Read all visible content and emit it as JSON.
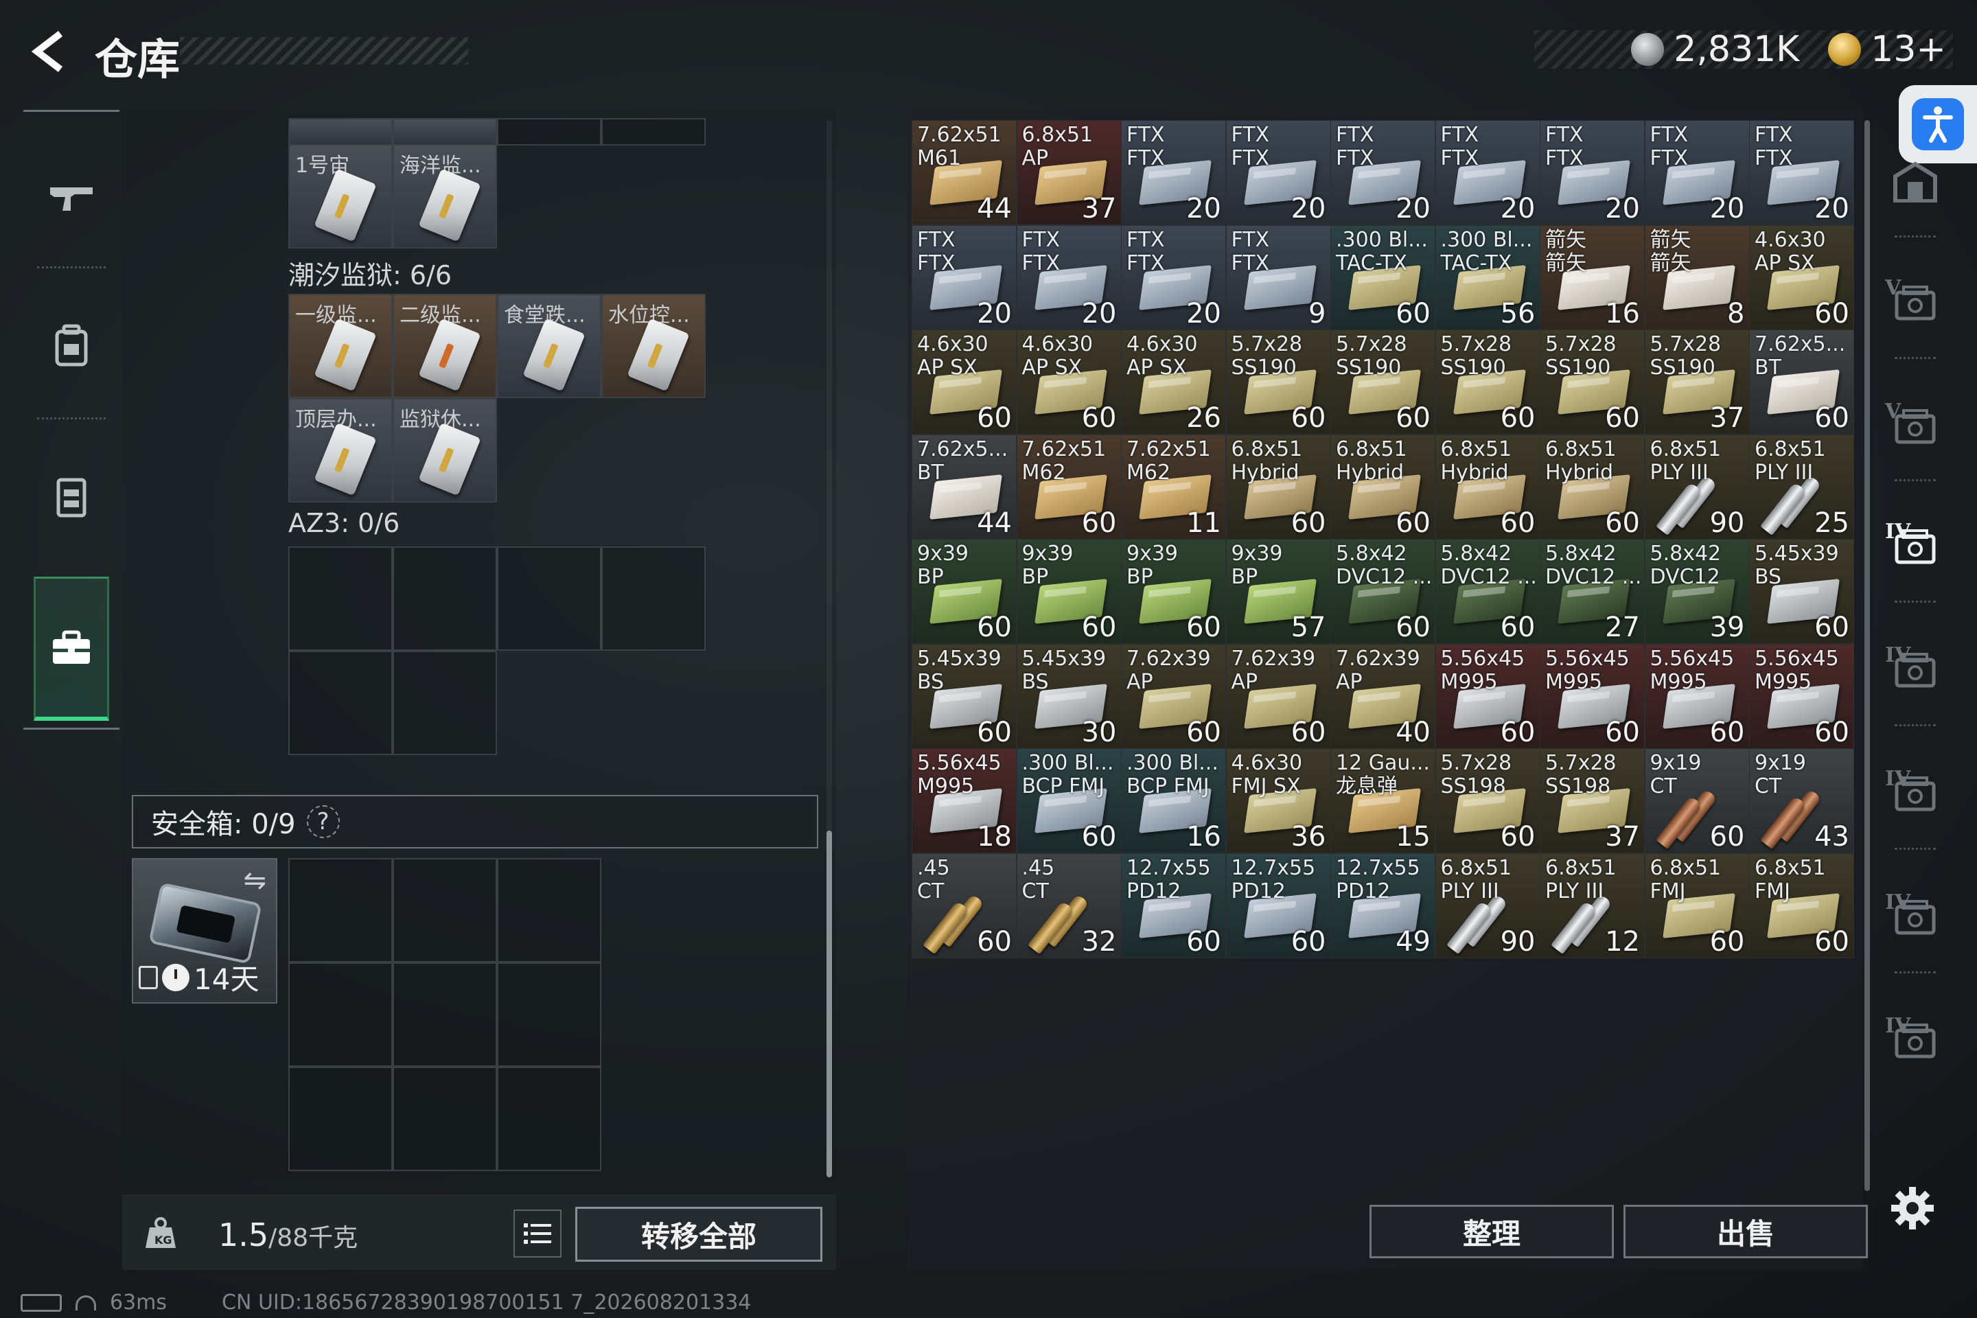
{
  "header": {
    "title": "仓库",
    "currency": {
      "coins": "2,831K",
      "bonds": "13+"
    }
  },
  "left_nav": [
    "weapon-icon",
    "backpack-icon",
    "vest-icon",
    "toolbox-icon"
  ],
  "keys": {
    "top_partial": [
      {
        "label": "1号宙",
        "tone": "key"
      },
      {
        "label": "海洋监...",
        "tone": "key"
      }
    ],
    "section_prison": {
      "label": "潮汐监狱: 6/6"
    },
    "prison_keys": [
      {
        "label": "一级监...",
        "tone": "brown"
      },
      {
        "label": "二级监...",
        "tone": "brown"
      },
      {
        "label": "食堂跌...",
        "tone": "key"
      },
      {
        "label": "水位控...",
        "tone": "brown"
      },
      {
        "label": "顶层办...",
        "tone": "key"
      },
      {
        "label": "监狱休...",
        "tone": "key"
      }
    ],
    "section_az3": {
      "label": "AZ3: 0/6"
    }
  },
  "safe_box": {
    "label": "安全箱: 0/9",
    "help": "?",
    "timer": "14天"
  },
  "footer": {
    "weight_value": "1.5",
    "weight_unit": "/88千克",
    "transfer_all": "转移全部",
    "sort": "整理",
    "sell": "出售"
  },
  "status": {
    "ping": "63ms",
    "uid": "CN UID:18656728390198700151 7_202608201334"
  },
  "ammo_items": [
    {
      "name": "7.62x51\nM61",
      "count": "44",
      "tone": "brown",
      "art": "b-tan"
    },
    {
      "name": "6.8x51\nAP",
      "count": "37",
      "tone": "maroon",
      "art": "b-tan"
    },
    {
      "name": "FTX\nFTX",
      "count": "20",
      "tone": "slate",
      "art": "b-steel"
    },
    {
      "name": "FTX\nFTX",
      "count": "20",
      "tone": "slate",
      "art": "b-steel"
    },
    {
      "name": "FTX\nFTX",
      "count": "20",
      "tone": "slate",
      "art": "b-steel"
    },
    {
      "name": "FTX\nFTX",
      "count": "20",
      "tone": "slate",
      "art": "b-steel"
    },
    {
      "name": "FTX\nFTX",
      "count": "20",
      "tone": "slate",
      "art": "b-steel"
    },
    {
      "name": "FTX\nFTX",
      "count": "20",
      "tone": "slate",
      "art": "b-steel"
    },
    {
      "name": "FTX\nFTX",
      "count": "20",
      "tone": "slate",
      "art": "b-steel"
    },
    {
      "name": "FTX\nFTX",
      "count": "20",
      "tone": "slate",
      "art": "b-steel"
    },
    {
      "name": "FTX\nFTX",
      "count": "20",
      "tone": "slate",
      "art": "b-steel"
    },
    {
      "name": "FTX\nFTX",
      "count": "20",
      "tone": "slate",
      "art": "b-steel"
    },
    {
      "name": "FTX\nFTX",
      "count": "9",
      "tone": "slate",
      "art": "b-steel"
    },
    {
      "name": ".300 Bl...\nTAC-TX",
      "count": "60",
      "tone": "teal",
      "art": "b-khaki"
    },
    {
      "name": ".300 Bl...\nTAC-TX",
      "count": "56",
      "tone": "teal",
      "art": "b-khaki"
    },
    {
      "name": "箭矢\n箭矢",
      "count": "16",
      "tone": "brown",
      "art": "b-white"
    },
    {
      "name": "箭矢\n箭矢",
      "count": "8",
      "tone": "brown",
      "art": "b-white"
    },
    {
      "name": "4.6x30\nAP SX",
      "count": "60",
      "tone": "olive",
      "art": "b-khaki"
    },
    {
      "name": "4.6x30\nAP SX",
      "count": "60",
      "tone": "olive",
      "art": "b-khaki"
    },
    {
      "name": "4.6x30\nAP SX",
      "count": "60",
      "tone": "olive",
      "art": "b-khaki"
    },
    {
      "name": "4.6x30\nAP SX",
      "count": "26",
      "tone": "olive",
      "art": "b-khaki"
    },
    {
      "name": "5.7x28\nSS190",
      "count": "60",
      "tone": "olive",
      "art": "b-khaki"
    },
    {
      "name": "5.7x28\nSS190",
      "count": "60",
      "tone": "olive",
      "art": "b-khaki"
    },
    {
      "name": "5.7x28\nSS190",
      "count": "60",
      "tone": "olive",
      "art": "b-khaki"
    },
    {
      "name": "5.7x28\nSS190",
      "count": "60",
      "tone": "olive",
      "art": "b-khaki"
    },
    {
      "name": "5.7x28\nSS190",
      "count": "37",
      "tone": "olive",
      "art": "b-khaki"
    },
    {
      "name": "7.62x5...\nBT",
      "count": "60",
      "tone": "gray",
      "art": "b-white"
    },
    {
      "name": "7.62x5...\nBT",
      "count": "44",
      "tone": "gray",
      "art": "b-white"
    },
    {
      "name": "7.62x51\nM62",
      "count": "60",
      "tone": "brown",
      "art": "b-tan"
    },
    {
      "name": "7.62x51\nM62",
      "count": "11",
      "tone": "brown",
      "art": "b-tan"
    },
    {
      "name": "6.8x51\nHybrid",
      "count": "60",
      "tone": "olive",
      "art": "b-sand"
    },
    {
      "name": "6.8x51\nHybrid",
      "count": "60",
      "tone": "olive",
      "art": "b-sand"
    },
    {
      "name": "6.8x51\nHybrid",
      "count": "60",
      "tone": "olive",
      "art": "b-sand"
    },
    {
      "name": "6.8x51\nHybrid",
      "count": "60",
      "tone": "olive",
      "art": "b-sand"
    },
    {
      "name": "6.8x51\nPLY III",
      "count": "90",
      "tone": "olive",
      "art": "shell-silver"
    },
    {
      "name": "6.8x51\nPLY III",
      "count": "25",
      "tone": "olive",
      "art": "shell-silver"
    },
    {
      "name": "9x39\nBP",
      "count": "60",
      "tone": "green",
      "art": "b-lime"
    },
    {
      "name": "9x39\nBP",
      "count": "60",
      "tone": "green",
      "art": "b-lime"
    },
    {
      "name": "9x39\nBP",
      "count": "60",
      "tone": "green",
      "art": "b-lime"
    },
    {
      "name": "9x39\nBP",
      "count": "57",
      "tone": "green",
      "art": "b-lime"
    },
    {
      "name": "5.8x42\nDVC12 ...",
      "count": "60",
      "tone": "green",
      "art": "b-darkgreen"
    },
    {
      "name": "5.8x42\nDVC12 ...",
      "count": "60",
      "tone": "green",
      "art": "b-darkgreen"
    },
    {
      "name": "5.8x42\nDVC12 ...",
      "count": "27",
      "tone": "green",
      "art": "b-darkgreen"
    },
    {
      "name": "5.8x42\nDVC12",
      "count": "39",
      "tone": "green",
      "art": "b-darkgreen"
    },
    {
      "name": "5.45x39\nBS",
      "count": "60",
      "tone": "olive",
      "art": "b-silver"
    },
    {
      "name": "5.45x39\nBS",
      "count": "60",
      "tone": "olive",
      "art": "b-silver"
    },
    {
      "name": "5.45x39\nBS",
      "count": "30",
      "tone": "olive",
      "art": "b-silver"
    },
    {
      "name": "7.62x39\nAP",
      "count": "60",
      "tone": "olive",
      "art": "b-khaki"
    },
    {
      "name": "7.62x39\nAP",
      "count": "60",
      "tone": "olive",
      "art": "b-khaki"
    },
    {
      "name": "7.62x39\nAP",
      "count": "40",
      "tone": "olive",
      "art": "b-khaki"
    },
    {
      "name": "5.56x45\nM995",
      "count": "60",
      "tone": "maroon",
      "art": "b-silver"
    },
    {
      "name": "5.56x45\nM995",
      "count": "60",
      "tone": "maroon",
      "art": "b-silver"
    },
    {
      "name": "5.56x45\nM995",
      "count": "60",
      "tone": "maroon",
      "art": "b-silver"
    },
    {
      "name": "5.56x45\nM995",
      "count": "60",
      "tone": "maroon",
      "art": "b-silver"
    },
    {
      "name": "5.56x45\nM995",
      "count": "18",
      "tone": "maroon",
      "art": "b-silver"
    },
    {
      "name": ".300 Bl...\nBCP FMJ",
      "count": "60",
      "tone": "teal",
      "art": "b-steel"
    },
    {
      "name": ".300 Bl...\nBCP FMJ",
      "count": "16",
      "tone": "teal",
      "art": "b-steel"
    },
    {
      "name": "4.6x30\nFMJ SX",
      "count": "36",
      "tone": "olive",
      "art": "b-khaki"
    },
    {
      "name": "12 Gau...\n龙息弹",
      "count": "15",
      "tone": "olive",
      "art": "b-tan"
    },
    {
      "name": "5.7x28\nSS198",
      "count": "60",
      "tone": "olive",
      "art": "b-khaki"
    },
    {
      "name": "5.7x28\nSS198",
      "count": "37",
      "tone": "olive",
      "art": "b-khaki"
    },
    {
      "name": "9x19\nCT",
      "count": "60",
      "tone": "gray",
      "art": "shell-copper"
    },
    {
      "name": "9x19\nCT",
      "count": "43",
      "tone": "gray",
      "art": "shell-copper"
    },
    {
      "name": ".45\nCT",
      "count": "60",
      "tone": "gray",
      "art": "shell-gold"
    },
    {
      "name": ".45\nCT",
      "count": "32",
      "tone": "gray",
      "art": "shell-gold"
    },
    {
      "name": "12.7x55\nPD12",
      "count": "60",
      "tone": "teal",
      "art": "b-steel"
    },
    {
      "name": "12.7x55\nPD12",
      "count": "60",
      "tone": "teal",
      "art": "b-steel"
    },
    {
      "name": "12.7x55\nPD12",
      "count": "49",
      "tone": "teal",
      "art": "b-steel"
    },
    {
      "name": "6.8x51\nPLY III",
      "count": "90",
      "tone": "olive",
      "art": "shell-silver"
    },
    {
      "name": "6.8x51\nPLY III",
      "count": "12",
      "tone": "olive",
      "art": "shell-silver"
    },
    {
      "name": "6.8x51\nFMJ",
      "count": "60",
      "tone": "olive",
      "art": "b-khaki"
    },
    {
      "name": "6.8x51\nFMJ",
      "count": "60",
      "tone": "olive",
      "art": "b-khaki"
    }
  ],
  "right_nav": [
    {
      "tier": "",
      "icon": "safehouse-icon",
      "active": false
    },
    {
      "tier": "V",
      "icon": "case-icon",
      "active": false
    },
    {
      "tier": "V",
      "icon": "case-icon",
      "active": false
    },
    {
      "tier": "IV",
      "icon": "ammo-case-icon",
      "active": true
    },
    {
      "tier": "IV",
      "icon": "ammo-case-icon",
      "active": false
    },
    {
      "tier": "IV",
      "icon": "ammo-case-icon",
      "active": false
    },
    {
      "tier": "IV",
      "icon": "medical-case-icon",
      "active": false
    },
    {
      "tier": "IV",
      "icon": "tool-case-icon",
      "active": false
    }
  ]
}
